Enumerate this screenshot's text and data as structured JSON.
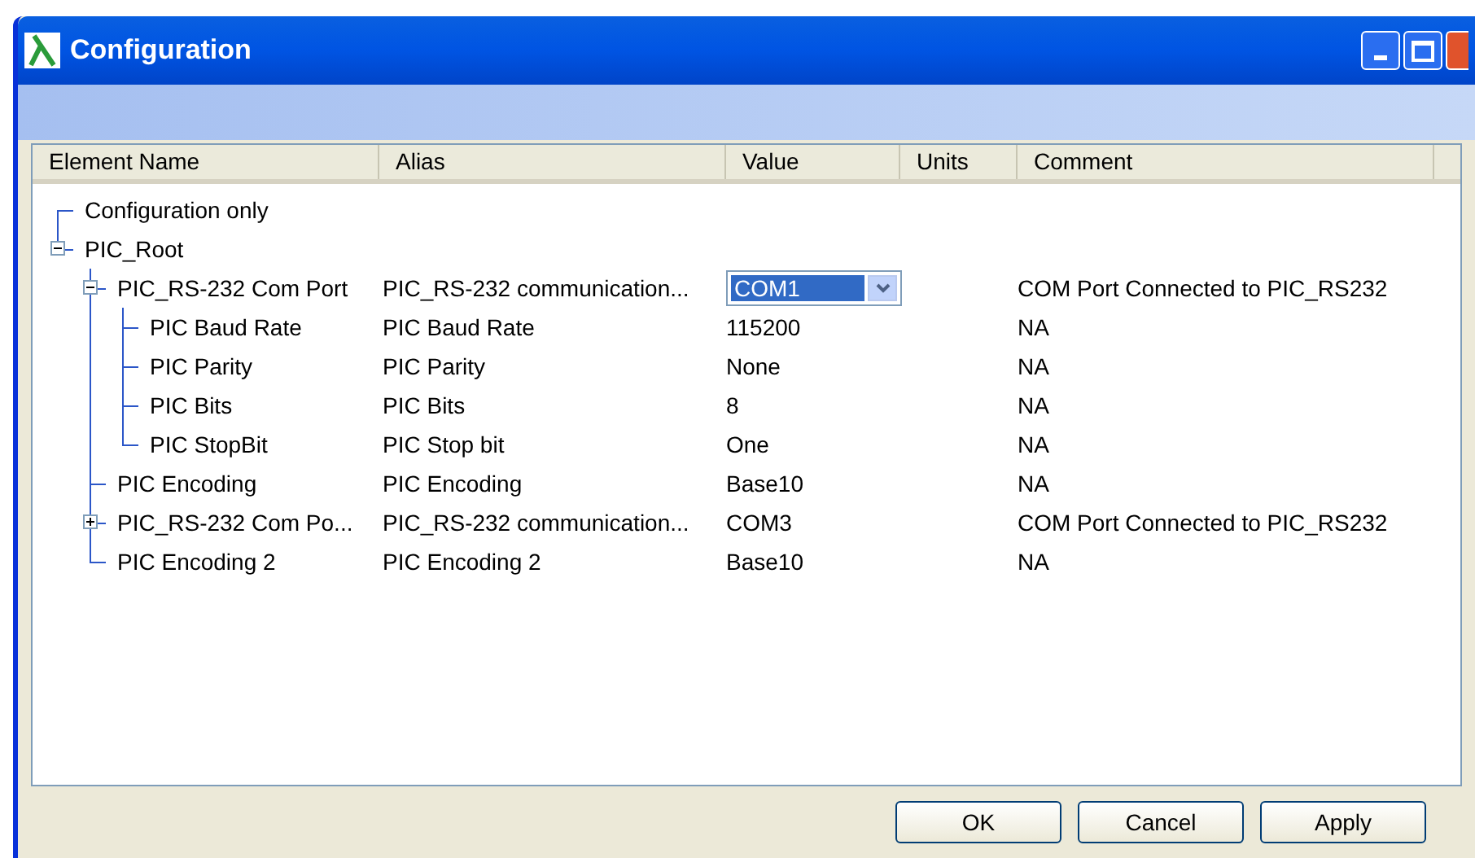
{
  "window": {
    "title": "Configuration"
  },
  "table": {
    "columns": [
      "Element Name",
      "Alias",
      "Value",
      "Units",
      "Comment"
    ],
    "rows": [
      {
        "name": "Configuration only"
      },
      {
        "name": "PIC_Root",
        "expanded": true,
        "children": [
          {
            "name": "PIC_RS-232 Com Port",
            "alias": "PIC_RS-232 communication...",
            "value": "COM1",
            "comment": "COM Port Connected to PIC_RS232",
            "editing": true,
            "expanded": true,
            "children": [
              {
                "name": "PIC Baud Rate",
                "alias": "PIC Baud Rate",
                "value": "115200",
                "comment": "NA",
                "editing": false
              },
              {
                "name": "PIC Parity",
                "alias": "PIC Parity",
                "value": "None",
                "comment": "NA",
                "editing": false
              },
              {
                "name": "PIC Bits",
                "alias": "PIC Bits",
                "value": "8",
                "comment": "NA",
                "editing": false
              },
              {
                "name": "PIC StopBit",
                "alias": "PIC Stop bit",
                "value": "One",
                "comment": "NA",
                "editing": false
              }
            ]
          },
          {
            "name": "PIC Encoding",
            "alias": "PIC Encoding",
            "value": "Base10",
            "comment": "NA",
            "editing": false
          },
          {
            "name": "PIC_RS-232 Com Po...",
            "alias": "PIC_RS-232 communication...",
            "value": "COM3",
            "comment": "COM Port Connected to PIC_RS232",
            "editing": false,
            "expanded": false
          },
          {
            "name": "PIC Encoding 2",
            "alias": "PIC Encoding 2",
            "value": "Base10",
            "comment": "NA",
            "editing": false
          }
        ]
      }
    ]
  },
  "buttons": [
    "OK",
    "Cancel",
    "Apply"
  ]
}
